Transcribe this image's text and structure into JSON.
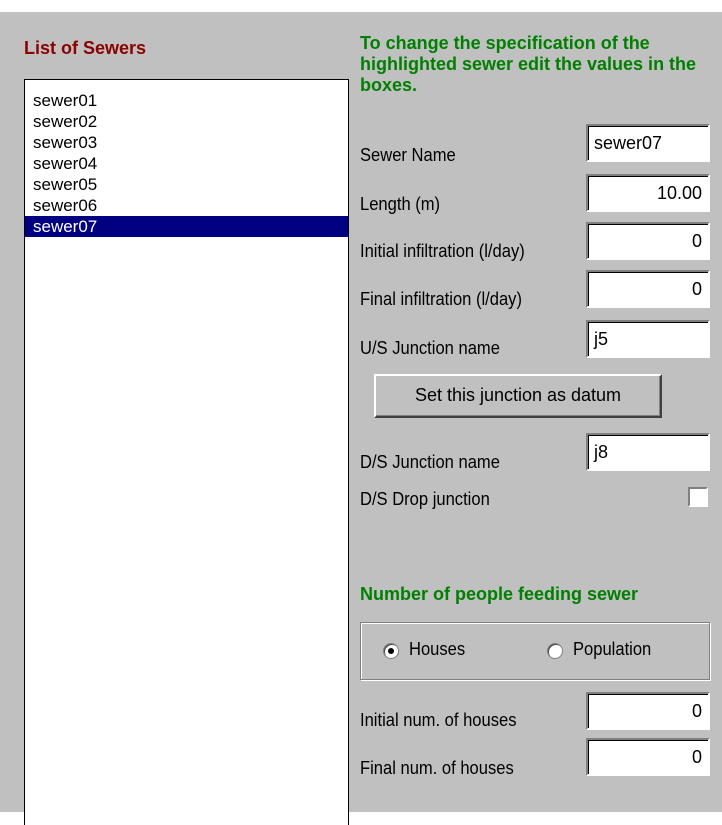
{
  "list": {
    "title": "List of Sewers",
    "items": [
      "sewer01",
      "sewer02",
      "sewer03",
      "sewer04",
      "sewer05",
      "sewer06",
      "sewer07"
    ],
    "selected_index": 6
  },
  "instructions": "To change the specification of the highlighted sewer edit the values in the boxes.",
  "fields": {
    "sewer_name": {
      "label": "Sewer Name",
      "value": "sewer07"
    },
    "length": {
      "label": "Length (m)",
      "value": "10.00"
    },
    "initial_infiltration": {
      "label": "Initial infiltration (l/day)",
      "value": "0"
    },
    "final_infiltration": {
      "label": "Final infiltration (l/day)",
      "value": "0"
    },
    "us_junction": {
      "label": "U/S Junction name",
      "value": "j5"
    },
    "ds_junction": {
      "label": "D/S Junction name",
      "value": "j8"
    },
    "ds_drop": {
      "label": "D/S Drop junction",
      "checked": false
    }
  },
  "datum_button": "Set this junction as datum",
  "people": {
    "heading": "Number of people feeding sewer",
    "options": [
      "Houses",
      "Population"
    ],
    "selected": "Houses"
  },
  "houses": {
    "initial": {
      "label": "Initial num. of houses",
      "value": "0"
    },
    "final": {
      "label": "Final num. of houses",
      "value": "0"
    }
  },
  "colors": {
    "panel": "#c0c0c0",
    "selection": "#000080",
    "heading_red": "#8b0000",
    "heading_green": "#008000"
  }
}
